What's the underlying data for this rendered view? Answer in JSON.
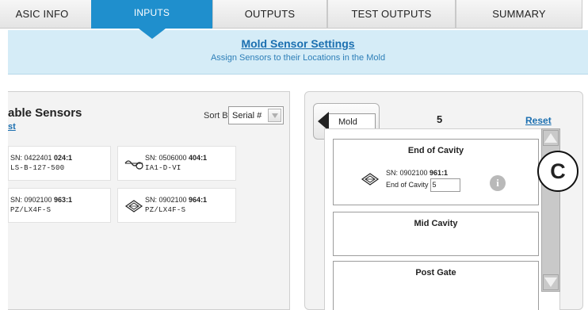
{
  "tabs": [
    {
      "label": "ASIC INFO",
      "active": false
    },
    {
      "label": "INPUTS",
      "active": true
    },
    {
      "label": "OUTPUTS",
      "active": false
    },
    {
      "label": "TEST OUTPUTS",
      "active": false
    },
    {
      "label": "SUMMARY",
      "active": false
    }
  ],
  "header": {
    "title": "Mold Sensor Settings",
    "subtitle": "Assign Sensors to their Locations in the Mold"
  },
  "sensors_panel": {
    "title": "able Sensors",
    "link": "st",
    "sort_label": "Sort By",
    "sort_value": "Serial #",
    "sensors": [
      {
        "sn_prefix": "SN: 0422401 ",
        "sn_bold": "024:1",
        "model": "LS-B-127-500",
        "icon": ""
      },
      {
        "sn_prefix": "SN: 0506000 ",
        "sn_bold": "404:1",
        "model": "IA1-D-VI",
        "icon": "sensor-probe-icon"
      },
      {
        "sn_prefix": "SN: 0902100 ",
        "sn_bold": "963:1",
        "model": "PZ/LX4F-S",
        "icon": ""
      },
      {
        "sn_prefix": "SN: 0902100 ",
        "sn_bold": "964:1",
        "model": "PZ/LX4F-S",
        "icon": "sensor-diamond-icon"
      }
    ]
  },
  "mold_panel": {
    "back_label": "Mold",
    "count": "5",
    "reset_label": "Reset",
    "locations": [
      {
        "title": "End of Cavity",
        "assigned_sn_prefix": "SN: 0902100 ",
        "assigned_sn_bold": "961:1",
        "cavity_label": "End of Cavity",
        "cavity_value": "5"
      },
      {
        "title": "Mid Cavity"
      },
      {
        "title": "Post Gate"
      }
    ]
  },
  "callout": {
    "label": "C"
  },
  "colors": {
    "tab_active": "#1f8fcd",
    "header_band": "#d5ecf7",
    "link": "#1b6fb0"
  }
}
